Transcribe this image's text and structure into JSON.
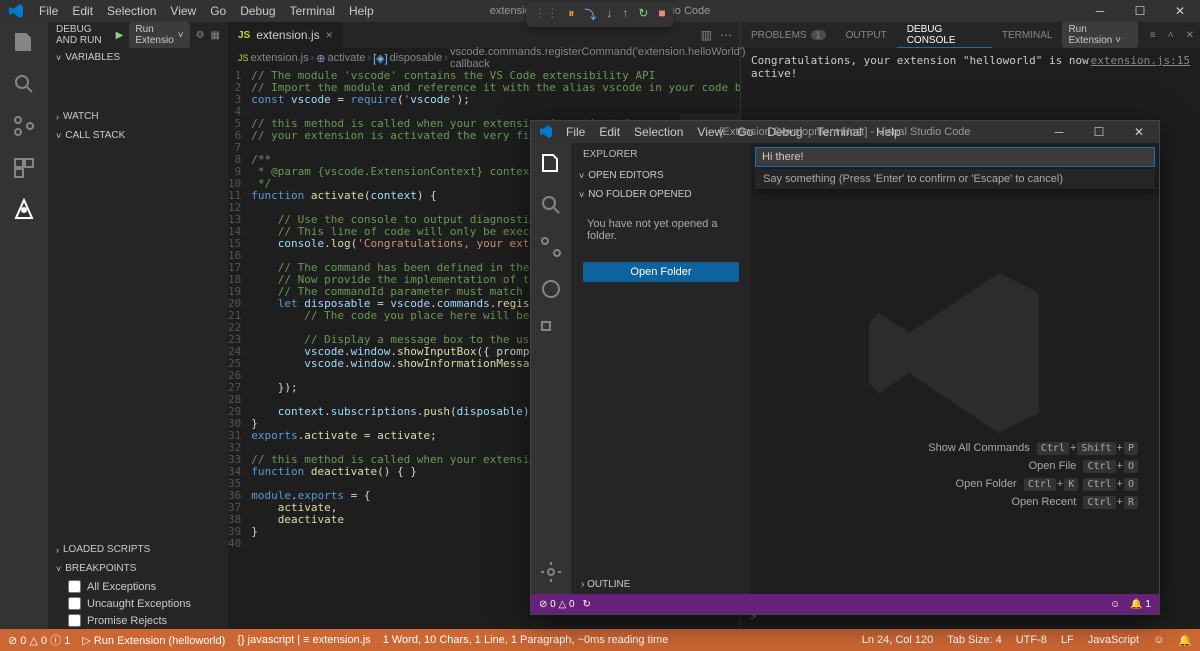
{
  "main_window": {
    "menu": [
      "File",
      "Edit",
      "Selection",
      "View",
      "Go",
      "Debug",
      "Terminal",
      "Help"
    ],
    "title": "extension.js - helloworld - Visual Studio Code",
    "activity_icons": [
      "files",
      "search",
      "scm",
      "debug",
      "extensions",
      "test"
    ],
    "debug_sidebar": {
      "header_label": "DEBUG AND RUN",
      "config_dropdown": "Run Extensio",
      "sections": {
        "variables": "VARIABLES",
        "watch": "WATCH",
        "callstack": "CALL STACK",
        "loaded": "LOADED SCRIPTS",
        "breakpoints": "BREAKPOINTS"
      },
      "breakpoint_items": [
        "All Exceptions",
        "Uncaught Exceptions",
        "Promise Rejects"
      ]
    },
    "tab": {
      "file": "extension.js"
    },
    "breadcrumb": [
      "extension.js",
      "activate",
      "disposable",
      "vscode.commands.registerCommand('extension.helloWorld') callback"
    ],
    "code_lines": [
      "// The module 'vscode' contains the VS Code extensibility API",
      "// Import the module and reference it with the alias vscode in your code below",
      "const vscode = require('vscode');",
      "",
      "// this method is called when your extension is activated",
      "// your extension is activated the very first time the command is executed",
      "",
      "/**",
      " * @param {vscode.ExtensionContext} context",
      " */",
      "function activate(context) {",
      "",
      "    // Use the console to output diagnostic information (console.log) and errors (console.error)",
      "    // This line of code will only be executed once when your extension is activated",
      "    console.log('Congratulations, your extension \"helloworld\" is now active!');",
      "",
      "    // The command has been defined in the package.json file",
      "    // Now provide the implementation of the command with registerCommand",
      "    // The commandId parameter must match the command field in package.json",
      "    let disposable = vscode.commands.registerCommand('extension.helloWorld', function () {",
      "        // The code you place here will be executed every time your command is executed",
      "",
      "        // Display a message box to the user",
      "        vscode.window.showInputBox({ prompt: \"Say something\" }).then( msg =>",
      "        vscode.window.showInformationMessage(msg));",
      "",
      "    });",
      "",
      "    context.subscriptions.push(disposable);",
      "}",
      "exports.activate = activate;",
      "",
      "// this method is called when your extension is deactivated",
      "function deactivate() { }",
      "",
      "module.exports = {",
      "    activate,",
      "    deactivate",
      "}",
      ""
    ],
    "right_panel": {
      "tabs": [
        {
          "label": "PROBLEMS",
          "badge": "1"
        },
        {
          "label": "OUTPUT"
        },
        {
          "label": "DEBUG CONSOLE",
          "active": true
        },
        {
          "label": "TERMINAL"
        }
      ],
      "dropdown": "Run Extension",
      "console_message": "Congratulations, your extension \"helloworld\" is now active!",
      "console_loc": "extension.js:15",
      "input_prompt": ">"
    },
    "statusbar": {
      "left": [
        "⊘ 0 △ 0 ⓘ 1",
        "▷ Run Extension (helloworld)",
        "{} javascript | ≡ extension.js",
        "1 Word, 10 Chars, 1 Line, 1 Paragraph, ~0ms reading time"
      ],
      "right": [
        "Ln 24, Col 120",
        "Tab Size: 4",
        "UTF-8",
        "LF",
        "JavaScript",
        "☺",
        "🔔"
      ]
    }
  },
  "devhost": {
    "menu": [
      "File",
      "Edit",
      "Selection",
      "View",
      "Go",
      "Debug",
      "Terminal",
      "Help"
    ],
    "title": "[Extension Development Host] - Visual Studio Code",
    "explorer_title": "EXPLORER",
    "open_editors": "OPEN EDITORS",
    "no_folder": "NO FOLDER OPENED",
    "no_folder_msg": "You have not yet opened a folder.",
    "open_folder_btn": "Open Folder",
    "input_value": "Hi there!",
    "input_hint": "Say something (Press 'Enter' to confirm or 'Escape' to cancel)",
    "commands": [
      {
        "label": "Show All Commands",
        "keys": [
          "Ctrl",
          "+",
          "Shift",
          "+",
          "P"
        ]
      },
      {
        "label": "Open File",
        "keys": [
          "Ctrl",
          "+",
          "O"
        ]
      },
      {
        "label": "Open Folder",
        "keys": [
          "Ctrl",
          "+",
          "K",
          "Ctrl",
          "+",
          "O"
        ]
      },
      {
        "label": "Open Recent",
        "keys": [
          "Ctrl",
          "+",
          "R"
        ]
      }
    ],
    "outline": "OUTLINE",
    "status_left": [
      "⊘ 0 △ 0",
      "↻"
    ],
    "status_right": [
      "☺",
      "🔔 1"
    ]
  }
}
